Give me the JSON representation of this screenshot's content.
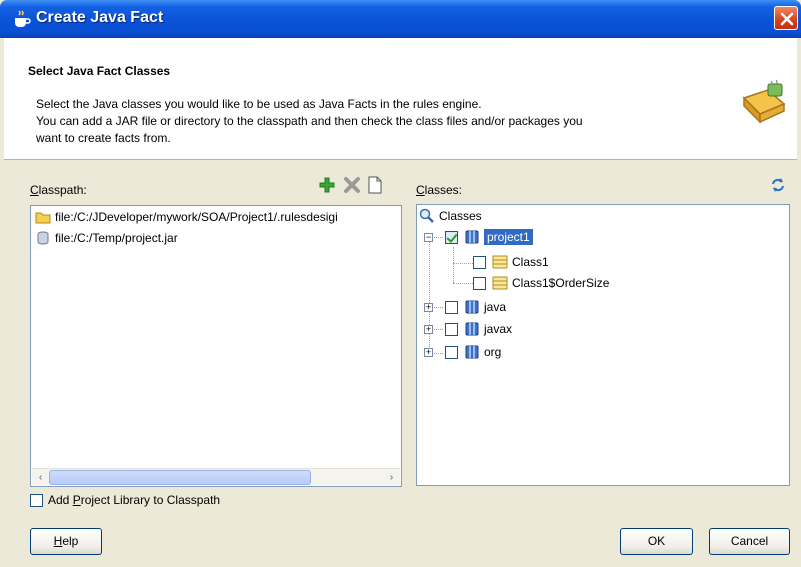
{
  "window": {
    "title": "Create Java Fact",
    "title_icon": "java-cup-icon",
    "close_icon": "close-icon"
  },
  "header": {
    "title": "Select Java Fact Classes",
    "description": [
      "Select the Java classes you would like to be used as Java Facts in the rules engine.",
      "You can add a JAR file or directory to the classpath and then check the class files and/or packages you",
      "want to create facts from."
    ],
    "icon": "java-fact-wizard-icon"
  },
  "classpath": {
    "label_mnemonic": "C",
    "label_rest": "lasspath:",
    "toolbar": {
      "add_icon": "add-icon",
      "remove_icon": "remove-icon",
      "new_icon": "new-document-icon"
    },
    "items": [
      {
        "text": "file:/C:/JDeveloper/mywork/SOA/Project1/.rulesdesigi",
        "icon": "folder-icon"
      },
      {
        "text": "file:/C:/Temp/project.jar",
        "icon": "jar-icon"
      }
    ]
  },
  "classes": {
    "label_mnemonic": "C",
    "label_rest": "lasses:",
    "refresh_icon": "refresh-icon",
    "root": {
      "label": "Classes",
      "icon": "magnifier-icon"
    },
    "nodes": [
      {
        "label": "project1",
        "type": "package",
        "checked": true,
        "selected": true,
        "expanded": true
      },
      {
        "label": "Class1",
        "type": "class",
        "checked": false
      },
      {
        "label": "Class1$OrderSize",
        "type": "class",
        "checked": false
      },
      {
        "label": "java",
        "type": "package",
        "checked": false,
        "expanded": false
      },
      {
        "label": "javax",
        "type": "package",
        "checked": false,
        "expanded": false
      },
      {
        "label": "org",
        "type": "package",
        "checked": false,
        "expanded": false
      }
    ]
  },
  "options": {
    "add_library_prefix": "Add ",
    "add_library_mnemonic": "P",
    "add_library_rest": "roject Library to Classpath",
    "add_library_checked": false
  },
  "buttons": {
    "help_mnemonic": "H",
    "help_rest": "elp",
    "ok": "OK",
    "cancel": "Cancel"
  },
  "colors": {
    "titlebar": "#0a52d8",
    "selection": "#316ac5",
    "dialog_bg": "#ece9d8"
  }
}
